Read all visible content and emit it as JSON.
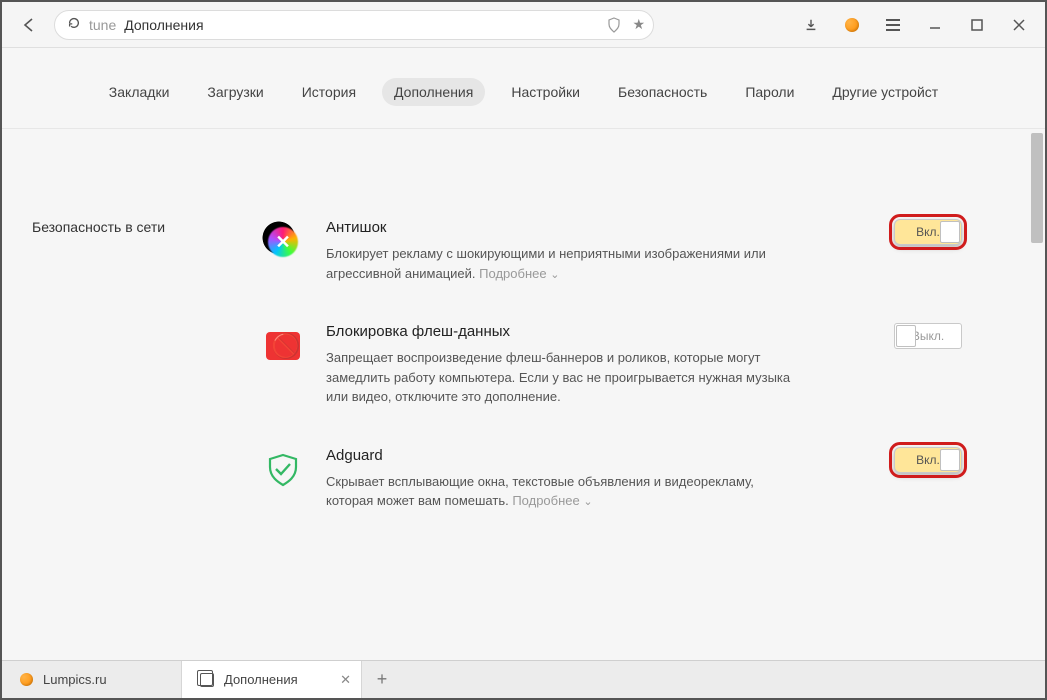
{
  "address_bar": {
    "prefix": "tune",
    "text": "Дополнения"
  },
  "nav": {
    "tabs": [
      {
        "label": "Закладки",
        "active": false
      },
      {
        "label": "Загрузки",
        "active": false
      },
      {
        "label": "История",
        "active": false
      },
      {
        "label": "Дополнения",
        "active": true
      },
      {
        "label": "Настройки",
        "active": false
      },
      {
        "label": "Безопасность",
        "active": false
      },
      {
        "label": "Пароли",
        "active": false
      },
      {
        "label": "Другие устройст",
        "active": false
      }
    ]
  },
  "section_title": "Безопасность в сети",
  "more_label": "Подробнее",
  "toggle_labels": {
    "on": "Вкл.",
    "off": "Выкл."
  },
  "addons": [
    {
      "icon": "antishock",
      "title": "Антишок",
      "desc": "Блокирует рекламу с шокирующими и неприятными изображениями или агрессивной анимацией.",
      "has_more": true,
      "state": "on",
      "highlighted": true
    },
    {
      "icon": "flash",
      "title": "Блокировка флеш-данных",
      "desc": "Запрещает воспроизведение флеш-баннеров и роликов, которые могут замедлить работу компьютера. Если у вас не проигрывается нужная музыка или видео, отключите это дополнение.",
      "has_more": false,
      "state": "off",
      "highlighted": false
    },
    {
      "icon": "adguard",
      "title": "Adguard",
      "desc": "Скрывает всплывающие окна, текстовые объявления и видеорекламу, которая может вам помешать.",
      "has_more": true,
      "state": "on",
      "highlighted": true
    }
  ],
  "browser_tabs": [
    {
      "label": "Lumpics.ru",
      "active": false
    },
    {
      "label": "Дополнения",
      "active": true
    }
  ]
}
